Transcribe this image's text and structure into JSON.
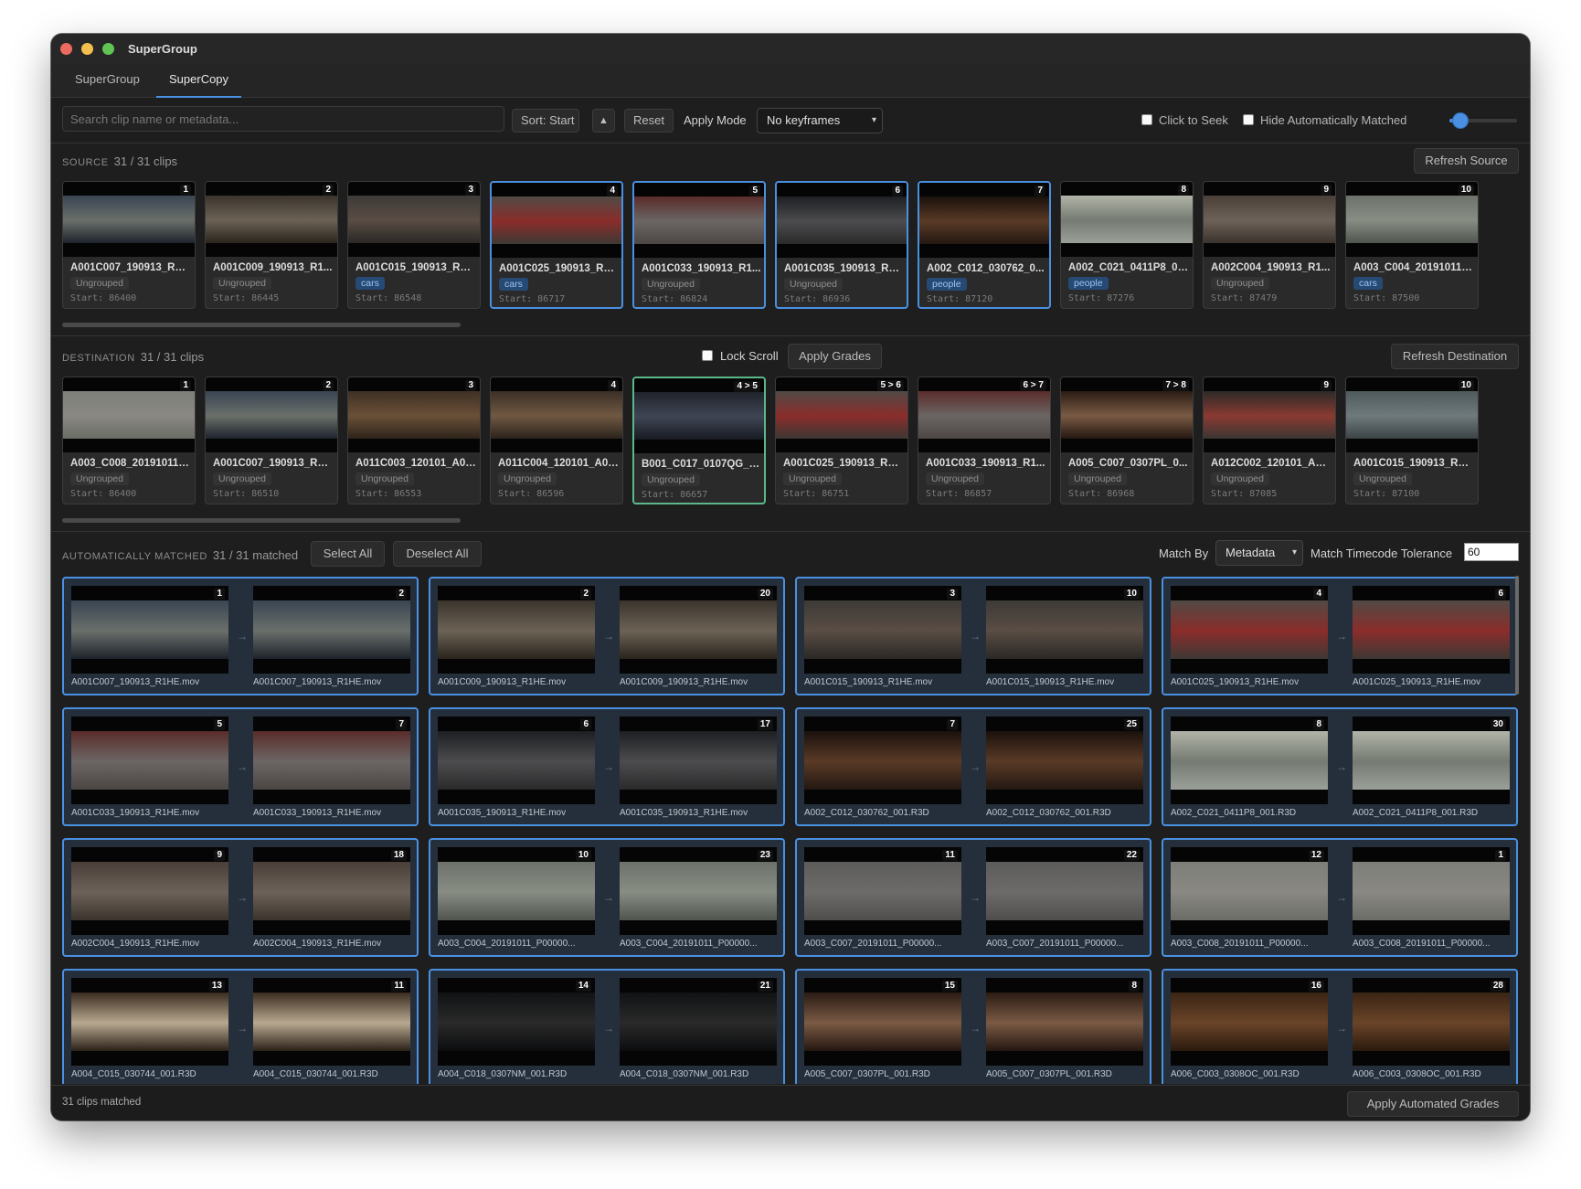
{
  "window": {
    "title": "SuperGroup"
  },
  "tabs": [
    {
      "label": "SuperGroup"
    },
    {
      "label": "SuperCopy"
    }
  ],
  "toolbar": {
    "search_placeholder": "Search clip name or metadata...",
    "sort_label": "Sort: Start",
    "sort_dir": "▲",
    "reset_label": "Reset",
    "apply_mode_label": "Apply Mode",
    "apply_mode_value": "No keyframes",
    "click_to_seek_label": "Click to Seek",
    "hide_auto_label": "Hide Automatically Matched",
    "slider_value": 0.16
  },
  "source": {
    "title": "SOURCE",
    "count": "31 / 31 clips",
    "refresh_label": "Refresh Source",
    "clips": [
      {
        "badge": "1",
        "name": "A001C007_190913_R1H...",
        "group": "Ungrouped",
        "start": "Start: 86400",
        "selected": false,
        "colors": [
          "#3a4553",
          "#6a6f6a",
          "#1d232b"
        ]
      },
      {
        "badge": "2",
        "name": "A001C009_190913_R1...",
        "group": "Ungrouped",
        "start": "Start: 86445",
        "selected": false,
        "colors": [
          "#3a342c",
          "#6c6255",
          "#2a241d"
        ]
      },
      {
        "badge": "3",
        "name": "A001C015_190913_R1H...",
        "group": "cars",
        "start": "Start: 86548",
        "selected": false,
        "colors": [
          "#3d3a37",
          "#5a4d44",
          "#2a2826"
        ]
      },
      {
        "badge": "4",
        "name": "A001C025_190913_R1H...",
        "group": "cars",
        "start": "Start: 86717",
        "selected": true,
        "colors": [
          "#514a45",
          "#8a2d2b",
          "#3d3834"
        ]
      },
      {
        "badge": "5",
        "name": "A001C033_190913_R1...",
        "group": "Ungrouped",
        "start": "Start: 86824",
        "selected": true,
        "colors": [
          "#5a2c2a",
          "#6b6664",
          "#4c4744"
        ]
      },
      {
        "badge": "6",
        "name": "A001C035_190913_R1H...",
        "group": "Ungrouped",
        "start": "Start: 86936",
        "selected": true,
        "colors": [
          "#1d1f22",
          "#4c4c4e",
          "#2b2a2b"
        ]
      },
      {
        "badge": "7",
        "name": "A002_C012_030762_0...",
        "group": "people",
        "start": "Start: 87120",
        "selected": true,
        "colors": [
          "#1a110c",
          "#5a3a26",
          "#231812"
        ]
      },
      {
        "badge": "8",
        "name": "A002_C021_0411P8_00...",
        "group": "people",
        "start": "Start: 87276",
        "selected": false,
        "colors": [
          "#b0b4a8",
          "#757a72",
          "#9aa098"
        ]
      },
      {
        "badge": "9",
        "name": "A002C004_190913_R1...",
        "group": "Ungrouped",
        "start": "Start: 87479",
        "selected": false,
        "colors": [
          "#4a3f38",
          "#6d6259",
          "#3b332c"
        ]
      },
      {
        "badge": "10",
        "name": "A003_C004_20191011_...",
        "group": "cars",
        "start": "Start: 87500",
        "selected": false,
        "colors": [
          "#6c716a",
          "#888d84",
          "#50554e"
        ]
      }
    ]
  },
  "destination": {
    "title": "DESTINATION",
    "count": "31 / 31 clips",
    "lock_scroll_label": "Lock Scroll",
    "apply_grades_label": "Apply Grades",
    "refresh_label": "Refresh Destination",
    "clips": [
      {
        "badge": "1",
        "name": "A003_C008_20191011_...",
        "group": "Ungrouped",
        "start": "Start: 86400",
        "selected": false,
        "colors": [
          "#7c7f78",
          "#8a8882",
          "#6a6d66"
        ]
      },
      {
        "badge": "2",
        "name": "A001C007_190913_R1H...",
        "group": "Ungrouped",
        "start": "Start: 86510",
        "selected": false,
        "colors": [
          "#3a4553",
          "#6a6f6a",
          "#1d232b"
        ]
      },
      {
        "badge": "3",
        "name": "A011C003_120101_A02...",
        "group": "Ungrouped",
        "start": "Start: 86553",
        "selected": false,
        "colors": [
          "#3e3024",
          "#6a5038",
          "#2d241b"
        ]
      },
      {
        "badge": "4",
        "name": "A011C004_120101_A02...",
        "group": "Ungrouped",
        "start": "Start: 86596",
        "selected": false,
        "colors": [
          "#3a2f26",
          "#705842",
          "#2b231c"
        ]
      },
      {
        "badge": "4 > 5",
        "name": "B001_C017_0107QG_00...",
        "group": "Ungrouped",
        "start": "Start: 86657",
        "selected": "green",
        "colors": [
          "#20232b",
          "#3f4554",
          "#171a21"
        ]
      },
      {
        "badge": "5 > 6",
        "name": "A001C025_190913_R1H...",
        "group": "Ungrouped",
        "start": "Start: 86751",
        "selected": false,
        "colors": [
          "#514a45",
          "#8a2d2b",
          "#3d3834"
        ]
      },
      {
        "badge": "6 > 7",
        "name": "A001C033_190913_R1...",
        "group": "Ungrouped",
        "start": "Start: 86857",
        "selected": false,
        "colors": [
          "#5a2c2a",
          "#6b6664",
          "#4c4744"
        ]
      },
      {
        "badge": "7 > 8",
        "name": "A005_C007_0307PL_0...",
        "group": "Ungrouped",
        "start": "Start: 86968",
        "selected": false,
        "colors": [
          "#2b1c14",
          "#7a5a44",
          "#241711"
        ]
      },
      {
        "badge": "9",
        "name": "A012C002_120101_A02...",
        "group": "Ungrouped",
        "start": "Start: 87085",
        "selected": false,
        "colors": [
          "#2c2a28",
          "#8a3a32",
          "#3a3632"
        ]
      },
      {
        "badge": "10",
        "name": "A001C015_190913_R1H...",
        "group": "Ungrouped",
        "start": "Start: 87100",
        "selected": false,
        "colors": [
          "#4f5a5c",
          "#6f7a7c",
          "#3b4345"
        ]
      }
    ]
  },
  "auto_matched": {
    "title": "AUTOMATICALLY MATCHED",
    "count": "31 / 31 matched",
    "select_all_label": "Select All",
    "deselect_all_label": "Deselect All",
    "match_by_label": "Match By",
    "match_by_value": "Metadata",
    "tolerance_label": "Match Timecode Tolerance",
    "tolerance_value": "60",
    "pairs": [
      {
        "l_badge": "1",
        "r_badge": "2",
        "l_name": "A001C007_190913_R1HE.mov",
        "r_name": "A001C007_190913_R1HE.mov",
        "colors": [
          "#3a4553",
          "#6a6f6a",
          "#1d232b"
        ]
      },
      {
        "l_badge": "2",
        "r_badge": "20",
        "l_name": "A001C009_190913_R1HE.mov",
        "r_name": "A001C009_190913_R1HE.mov",
        "colors": [
          "#3a342c",
          "#6c6255",
          "#2a241d"
        ]
      },
      {
        "l_badge": "3",
        "r_badge": "10",
        "l_name": "A001C015_190913_R1HE.mov",
        "r_name": "A001C015_190913_R1HE.mov",
        "colors": [
          "#3d3a37",
          "#5a4d44",
          "#2a2826"
        ]
      },
      {
        "l_badge": "4",
        "r_badge": "6",
        "l_name": "A001C025_190913_R1HE.mov",
        "r_name": "A001C025_190913_R1HE.mov",
        "colors": [
          "#514a45",
          "#8a2d2b",
          "#3d3834"
        ]
      },
      {
        "l_badge": "5",
        "r_badge": "7",
        "l_name": "A001C033_190913_R1HE.mov",
        "r_name": "A001C033_190913_R1HE.mov",
        "colors": [
          "#5a2c2a",
          "#6b6664",
          "#4c4744"
        ]
      },
      {
        "l_badge": "6",
        "r_badge": "17",
        "l_name": "A001C035_190913_R1HE.mov",
        "r_name": "A001C035_190913_R1HE.mov",
        "colors": [
          "#1d1f22",
          "#4c4c4e",
          "#2b2a2b"
        ]
      },
      {
        "l_badge": "7",
        "r_badge": "25",
        "l_name": "A002_C012_030762_001.R3D",
        "r_name": "A002_C012_030762_001.R3D",
        "colors": [
          "#1a110c",
          "#5a3a26",
          "#231812"
        ]
      },
      {
        "l_badge": "8",
        "r_badge": "30",
        "l_name": "A002_C021_0411P8_001.R3D",
        "r_name": "A002_C021_0411P8_001.R3D",
        "colors": [
          "#b0b4a8",
          "#757a72",
          "#9aa098"
        ]
      },
      {
        "l_badge": "9",
        "r_badge": "18",
        "l_name": "A002C004_190913_R1HE.mov",
        "r_name": "A002C004_190913_R1HE.mov",
        "colors": [
          "#4a3f38",
          "#6d6259",
          "#3b332c"
        ]
      },
      {
        "l_badge": "10",
        "r_badge": "23",
        "l_name": "A003_C004_20191011_P00000...",
        "r_name": "A003_C004_20191011_P00000...",
        "colors": [
          "#6c716a",
          "#888d84",
          "#50554e"
        ]
      },
      {
        "l_badge": "11",
        "r_badge": "22",
        "l_name": "A003_C007_20191011_P00000...",
        "r_name": "A003_C007_20191011_P00000...",
        "colors": [
          "#5c5c5a",
          "#6d6b69",
          "#4f4e4c"
        ]
      },
      {
        "l_badge": "12",
        "r_badge": "1",
        "l_name": "A003_C008_20191011_P00000...",
        "r_name": "A003_C008_20191011_P00000...",
        "colors": [
          "#7c7f78",
          "#8a8882",
          "#6a6d66"
        ]
      },
      {
        "l_badge": "13",
        "r_badge": "11",
        "l_name": "A004_C015_030744_001.R3D",
        "r_name": "A004_C015_030744_001.R3D",
        "colors": [
          "#3a2c20",
          "#b8a890",
          "#2b2118"
        ]
      },
      {
        "l_badge": "14",
        "r_badge": "21",
        "l_name": "A004_C018_0307NM_001.R3D",
        "r_name": "A004_C018_0307NM_001.R3D",
        "colors": [
          "#101214",
          "#2a2a2a",
          "#0c0d0f"
        ]
      },
      {
        "l_badge": "15",
        "r_badge": "8",
        "l_name": "A005_C007_0307PL_001.R3D",
        "r_name": "A005_C007_0307PL_001.R3D",
        "colors": [
          "#2b1c14",
          "#7a5a44",
          "#241711"
        ]
      },
      {
        "l_badge": "16",
        "r_badge": "28",
        "l_name": "A006_C003_0308OC_001.R3D",
        "r_name": "A006_C003_0308OC_001.R3D",
        "colors": [
          "#3a2414",
          "#6a4428",
          "#2a1a0e"
        ]
      }
    ]
  },
  "footer": {
    "status": "31 clips matched",
    "apply_auto_label": "Apply Automated Grades"
  },
  "colors": {
    "accent": "#4a90e2",
    "green": "#5cb88a",
    "tag_bg": "#274a75"
  }
}
